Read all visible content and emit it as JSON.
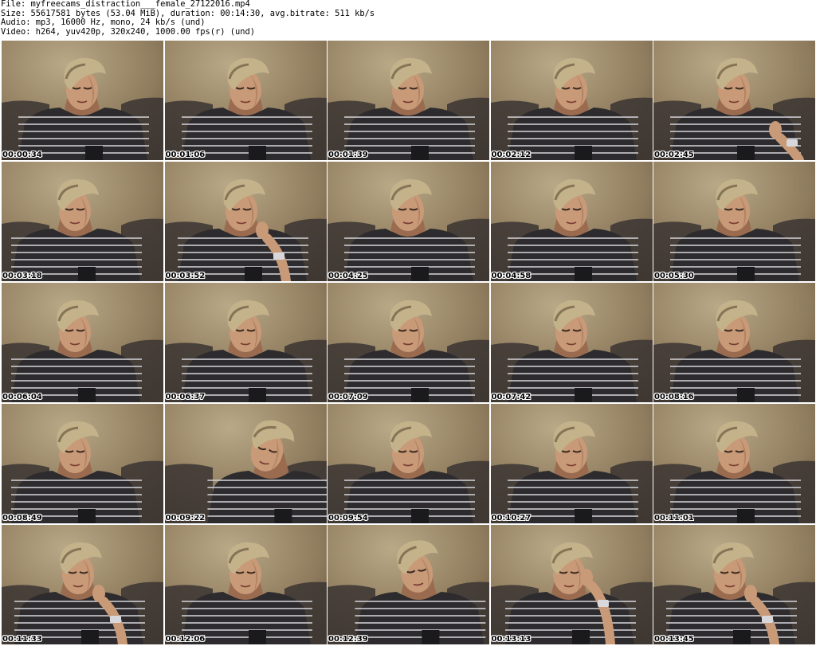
{
  "header": {
    "lines": [
      "File: myfreecams_distraction___female_27122016.mp4",
      "Size: 55617581 bytes (53.04 MiB), duration: 00:14:30, avg.bitrate: 511 kb/s",
      "Audio: mp3, 16000 Hz, mono, 24 kb/s (und)",
      "Video: h264, yuv420p, 320x240, 1000.00 fps(r) (und)"
    ]
  },
  "thumbnails": [
    {
      "timestamp": "00:00:34",
      "pose": "center"
    },
    {
      "timestamp": "00:01:06",
      "pose": "center"
    },
    {
      "timestamp": "00:01:39",
      "pose": "center"
    },
    {
      "timestamp": "00:02:12",
      "pose": "center"
    },
    {
      "timestamp": "00:02:45",
      "pose": "hand-chest"
    },
    {
      "timestamp": "00:03:18",
      "pose": "left"
    },
    {
      "timestamp": "00:03:52",
      "pose": "hand-chin"
    },
    {
      "timestamp": "00:04:25",
      "pose": "center"
    },
    {
      "timestamp": "00:04:58",
      "pose": "center"
    },
    {
      "timestamp": "00:05:30",
      "pose": "center"
    },
    {
      "timestamp": "00:06:04",
      "pose": "left"
    },
    {
      "timestamp": "00:06:37",
      "pose": "center"
    },
    {
      "timestamp": "00:07:09",
      "pose": "center"
    },
    {
      "timestamp": "00:07:42",
      "pose": "center"
    },
    {
      "timestamp": "00:08:16",
      "pose": "center"
    },
    {
      "timestamp": "00:08:49",
      "pose": "left"
    },
    {
      "timestamp": "00:09:22",
      "pose": "tilt"
    },
    {
      "timestamp": "00:09:54",
      "pose": "center"
    },
    {
      "timestamp": "00:10:27",
      "pose": "center"
    },
    {
      "timestamp": "00:11:01",
      "pose": "center"
    },
    {
      "timestamp": "00:11:33",
      "pose": "hand-chin"
    },
    {
      "timestamp": "00:12:06",
      "pose": "center"
    },
    {
      "timestamp": "00:12:39",
      "pose": "turned"
    },
    {
      "timestamp": "00:13:13",
      "pose": "hand-ear"
    },
    {
      "timestamp": "00:13:45",
      "pose": "hand-chin"
    }
  ],
  "colors": {
    "wall_light": "#b9a987",
    "wall_dark": "#5e4c35",
    "sofa": "#3a3431",
    "shirt": "#2d2b2d",
    "stripe": "#cfcfd3",
    "skin": "#c99a78",
    "skin_shadow": "#9a6b4f",
    "hair": "#c3b28a",
    "hair_dark": "#6b5a40",
    "watch": "#d8d8dc"
  }
}
